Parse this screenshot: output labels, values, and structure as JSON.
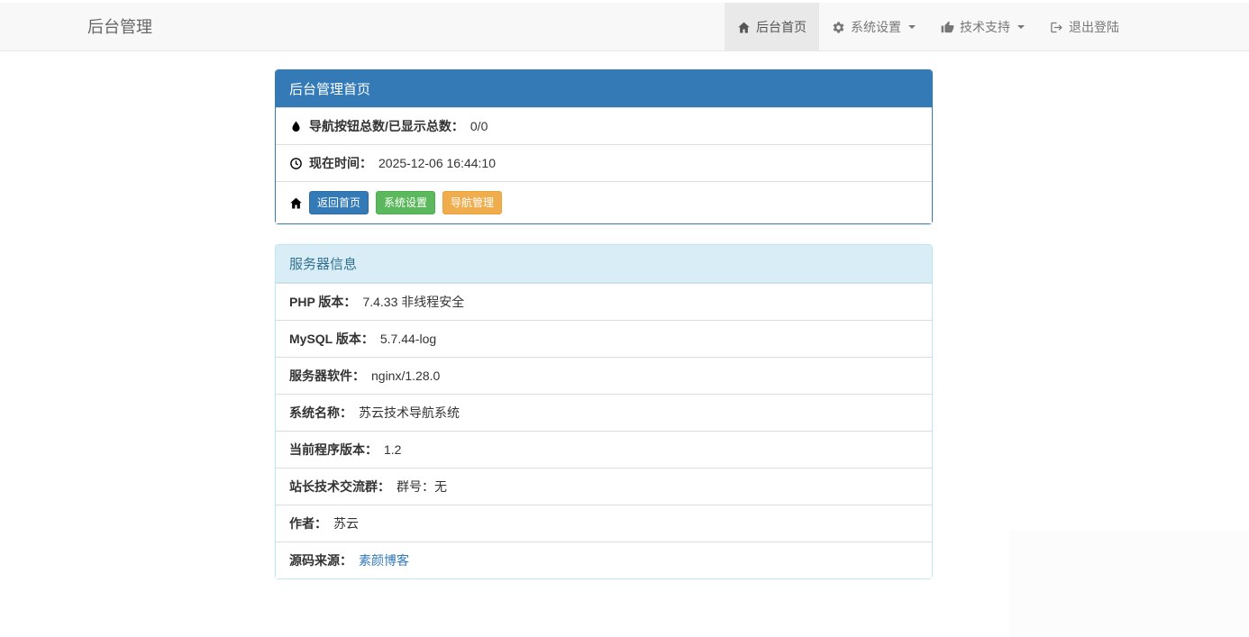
{
  "navbar": {
    "brand": "后台管理",
    "items": [
      {
        "label": "后台首页",
        "icon": "home-icon",
        "active": true,
        "caret": false
      },
      {
        "label": "系统设置",
        "icon": "gear-icon",
        "active": false,
        "caret": true
      },
      {
        "label": "技术支持",
        "icon": "thumbs-up-icon",
        "active": false,
        "caret": true
      },
      {
        "label": "退出登陆",
        "icon": "logout-icon",
        "active": false,
        "caret": false
      }
    ]
  },
  "dashboard_panel": {
    "title": "后台管理首页",
    "stats_row": {
      "icon": "droplet-icon",
      "label": "导航按钮总数/已显示总数：",
      "value": "0/0"
    },
    "time_row": {
      "icon": "clock-icon",
      "label": "现在时间：",
      "value": "2025-12-06 16:44:10"
    },
    "actions_row": {
      "icon": "home-icon",
      "buttons": [
        {
          "label": "返回首页",
          "color": "#337ab7"
        },
        {
          "label": "系统设置",
          "color": "#5cb85c"
        },
        {
          "label": "导航管理",
          "color": "#f0ad4e"
        }
      ]
    }
  },
  "server_panel": {
    "title": "服务器信息",
    "rows": [
      {
        "label": "PHP 版本：",
        "value": "7.4.33 非线程安全"
      },
      {
        "label": "MySQL 版本：",
        "value": "5.7.44-log"
      },
      {
        "label": "服务器软件：",
        "value": "nginx/1.28.0"
      },
      {
        "label": "系统名称：",
        "value": "苏云技术导航系统"
      },
      {
        "label": "当前程序版本：",
        "value": "1.2"
      },
      {
        "label": "站长技术交流群：",
        "value": "群号：无"
      },
      {
        "label": "作者：",
        "value": "苏云"
      },
      {
        "label": "源码来源：",
        "value": "素颜博客",
        "link": true
      }
    ]
  },
  "colors": {
    "navbar_bg": "#f8f8f8",
    "navbar_border": "#e7e7e7",
    "navbar_active_bg": "#e9e9e9",
    "primary": "#337ab7",
    "success": "#5cb85c",
    "warning": "#f0ad4e",
    "info_header_bg": "#d9edf7",
    "info_header_text": "#31708f",
    "info_border": "#bce8f1",
    "link": "#337ab7"
  }
}
